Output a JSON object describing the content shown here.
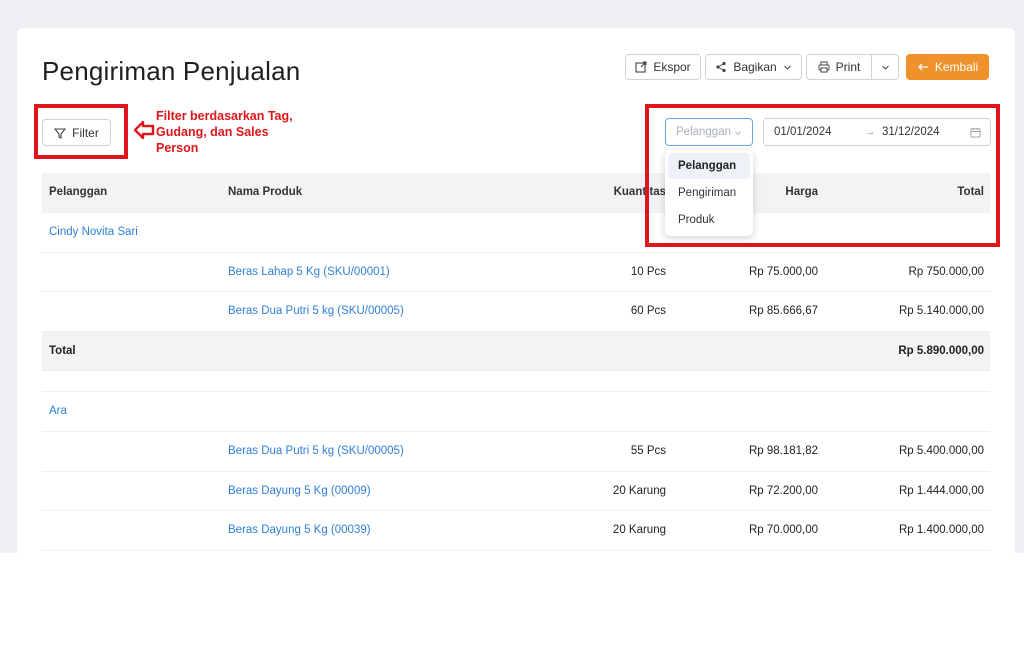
{
  "page": {
    "title": "Pengiriman Penjualan"
  },
  "toolbar": {
    "export_label": "Ekspor",
    "share_label": "Bagikan",
    "print_label": "Print",
    "back_label": "Kembali"
  },
  "filter": {
    "button_label": "Filter",
    "annotation": "Filter berdasarkan Tag, Gudang, dan Sales Person"
  },
  "groupby": {
    "placeholder": "Pelanggan",
    "options": [
      "Pelanggan",
      "Pengiriman",
      "Produk"
    ],
    "active": "Pelanggan"
  },
  "daterange": {
    "start": "01/01/2024",
    "separator": "→",
    "end": "31/12/2024"
  },
  "table": {
    "columns": [
      "Pelanggan",
      "Nama Produk",
      "Kuantitas",
      "Harga",
      "Total"
    ],
    "groups": [
      {
        "customer": "Cindy Novita Sari",
        "rows": [
          {
            "product": "Beras Lahap 5 Kg (SKU/00001)",
            "qty": "10 Pcs",
            "price": "Rp 75.000,00",
            "total": "Rp 750.000,00"
          },
          {
            "product": "Beras Dua Putri 5 kg (SKU/00005)",
            "qty": "60 Pcs",
            "price": "Rp 85.666,67",
            "total": "Rp 5.140.000,00"
          }
        ],
        "total_label": "Total",
        "total_value": "Rp 5.890.000,00"
      },
      {
        "customer": "Ara",
        "rows": [
          {
            "product": "Beras Dua Putri 5 kg (SKU/00005)",
            "qty": "55 Pcs",
            "price": "Rp 98.181,82",
            "total": "Rp 5.400.000,00"
          },
          {
            "product": "Beras Dayung 5 Kg (00009)",
            "qty": "20 Karung",
            "price": "Rp 72.200,00",
            "total": "Rp 1.444.000,00"
          },
          {
            "product": "Beras Dayung 5 Kg (00039)",
            "qty": "20 Karung",
            "price": "Rp 70.000,00",
            "total": "Rp 1.400.000,00"
          }
        ]
      }
    ]
  },
  "colors": {
    "accent": "#f0922b",
    "link": "#2f7fd8",
    "annotation": "#e0151b"
  }
}
